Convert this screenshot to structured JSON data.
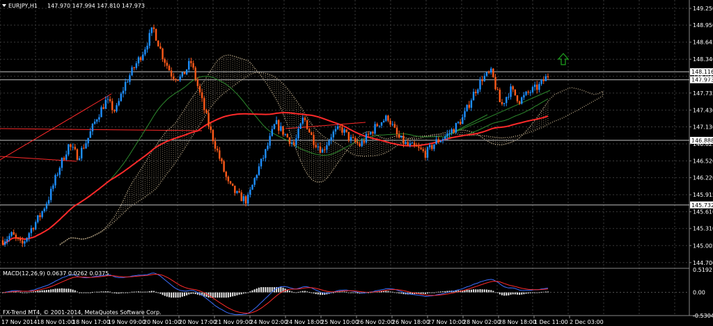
{
  "header": {
    "symbol_timeframe": "EURJPY,H1",
    "ohlc": "147.970 147.994 147.810 147.973"
  },
  "footer": {
    "copyright": "FX-Trend MT4, © 2001-2014, MetaQuotes Software Corp."
  },
  "macd": {
    "label": "MACD(12,26,9) 0.0637 0.0262 0.0375",
    "axis_labels": [
      "0.5192",
      "0.00",
      "-0.5304"
    ]
  },
  "colors": {
    "background": "#000000",
    "grid": "#3a3a3a",
    "bull": "#1e90ff",
    "bear": "#ff5a1a",
    "ma_red": "#ff2a2a",
    "ma_green": "#2e8b2e",
    "ichimoku": "#f5deb3",
    "hline": "#c0c0c0",
    "arrow": "#1fa31f"
  },
  "chart_data": {
    "type": "candlestick",
    "symbol": "EURJPY",
    "timeframe": "H1",
    "y_ticks": [
      149.25,
      148.95,
      148.645,
      148.34,
      148.035,
      147.735,
      147.43,
      147.13,
      146.825,
      146.52,
      146.22,
      145.915,
      145.61,
      145.31,
      145.005,
      144.7
    ],
    "ylim": [
      144.61,
      149.4
    ],
    "x_ticks": [
      "17 Nov 2014",
      "18 Nov 01:00",
      "18 Nov 17:00",
      "19 Nov 09:00",
      "20 Nov 01:00",
      "20 Nov 17:00",
      "21 Nov 09:00",
      "24 Nov 02:00",
      "24 Nov 18:00",
      "25 Nov 10:00",
      "26 Nov 02:00",
      "26 Nov 18:00",
      "27 Nov 10:00",
      "28 Nov 02:00",
      "28 Nov 18:00",
      "1 Dec 11:00",
      "2 Dec 03:00"
    ],
    "horizontal_levels": [
      {
        "label": "148.116",
        "value": 148.116
      },
      {
        "label": "147.973",
        "value": 147.973
      },
      {
        "label": "146.888",
        "value": 146.888
      },
      {
        "label": "145.732",
        "value": 145.732
      }
    ],
    "price_path": [
      145.1,
      145.2,
      145.0,
      145.3,
      145.55,
      145.9,
      146.4,
      146.8,
      146.6,
      146.9,
      147.3,
      147.6,
      147.4,
      147.9,
      148.2,
      148.5,
      148.9,
      148.4,
      148.05,
      148.0,
      148.3,
      147.7,
      147.1,
      146.6,
      146.1,
      145.9,
      145.8,
      146.3,
      146.7,
      147.2,
      147.0,
      146.8,
      147.3,
      146.9,
      146.7,
      147.0,
      147.1,
      146.9,
      146.8,
      147.0,
      147.2,
      147.3,
      146.95,
      146.8,
      146.75,
      146.65,
      146.85,
      146.95,
      147.1,
      147.3,
      147.7,
      148.0,
      148.1,
      147.5,
      147.8,
      147.6,
      147.75,
      147.85,
      148.05
    ],
    "macd_ylim": [
      -0.5304,
      0.5192
    ]
  }
}
